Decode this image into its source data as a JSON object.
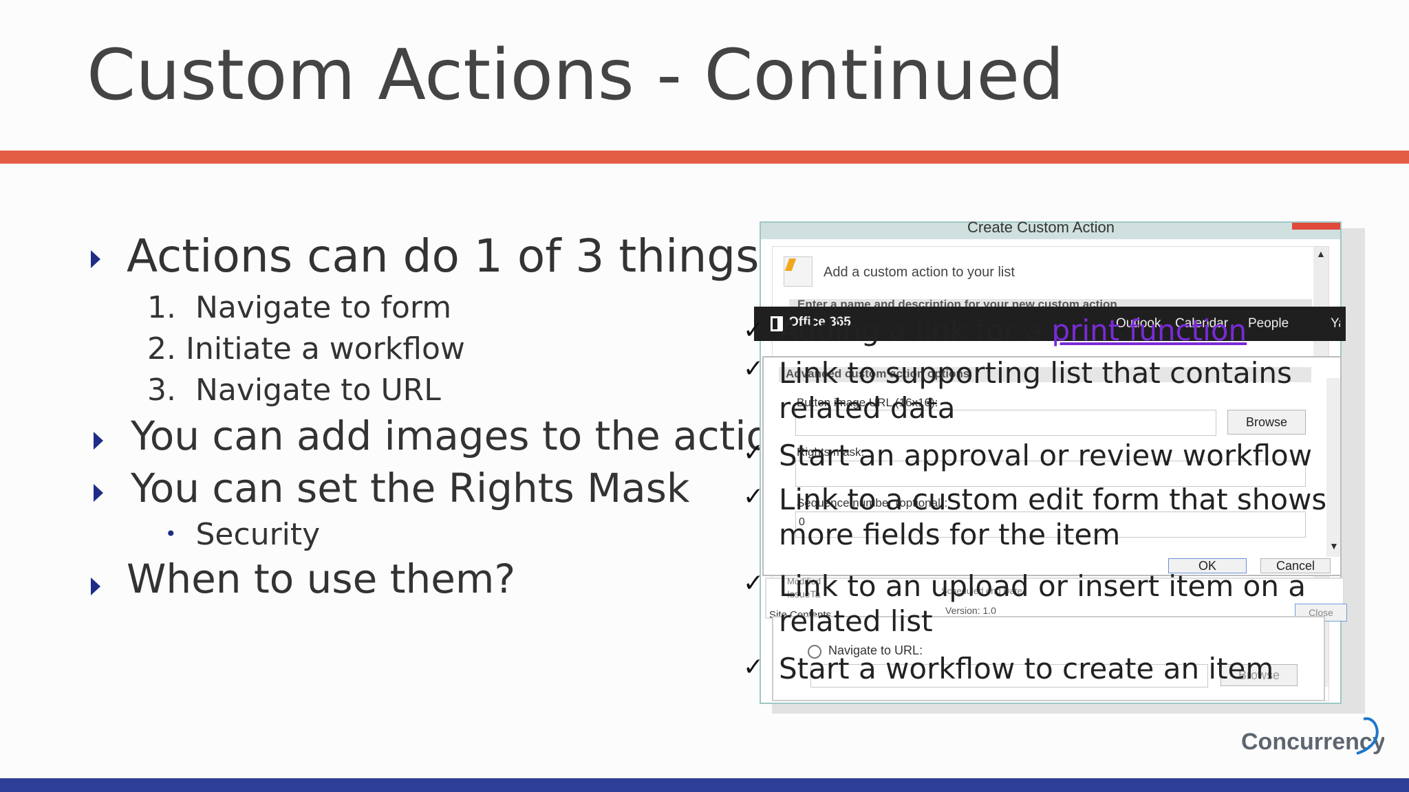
{
  "slide": {
    "title": "Custom Actions - Continued",
    "bullets": [
      {
        "text": "Actions can do 1 of 3 things"
      },
      {
        "text": "You can add images to the actions"
      },
      {
        "text": "You can set the Rights Mask"
      },
      {
        "text": "When to use them?"
      }
    ],
    "numbered": [
      {
        "num": "1.",
        "text": "Navigate to form"
      },
      {
        "num": "2.",
        "text": "Initiate a workflow"
      },
      {
        "num": "3.",
        "text": "Navigate to URL"
      }
    ],
    "sub_bullet": {
      "marker": "•",
      "text": "Security"
    },
    "logo_text": "Concurrency"
  },
  "screenshot": {
    "dialog_title": "Create Custom Action",
    "header_text": "Add a custom action to your list",
    "section_bar": "Enter a name and description for your new custom action",
    "o365_brand": "Office 365",
    "o365_nav": [
      "Outlook",
      "Calendar",
      "People",
      "Yammer"
    ],
    "advanced_header": "Advanced custom action options",
    "button_image_label": "Button image URL (16x16):",
    "browse_label": "Browse",
    "rights_mask_label": "Rights mask:",
    "sequence_label": "Sequence number (optional):",
    "sequence_value": "0",
    "ok_label": "OK",
    "cancel_label": "Cancel",
    "version_text": "Version: 1.0",
    "site_contents": "Site Contents",
    "close_label": "Close",
    "navigate_url": "Navigate to URL:",
    "browse2_label": "Browse",
    "frag_modified": "Modified",
    "frag_issue": "IssueTa",
    "frag_scheduled": "Scheduled end Date"
  },
  "overlay": {
    "items": [
      {
        "check": "✓",
        "text": "Adding a link for a ",
        "link": "print function"
      },
      {
        "check": "✓",
        "text": "Link to supporting list that contains",
        "text2": "related data"
      },
      {
        "check": "✓",
        "text": "Start an approval or review workflow"
      },
      {
        "check": "✓",
        "text": "Link to a custom edit form that shows",
        "text2": "more fields for the item"
      },
      {
        "check": "✓",
        "text": "Link to an upload or insert item on a",
        "text2": "related list"
      },
      {
        "check": "✓",
        "text": "Start a workflow to create an item"
      }
    ]
  }
}
